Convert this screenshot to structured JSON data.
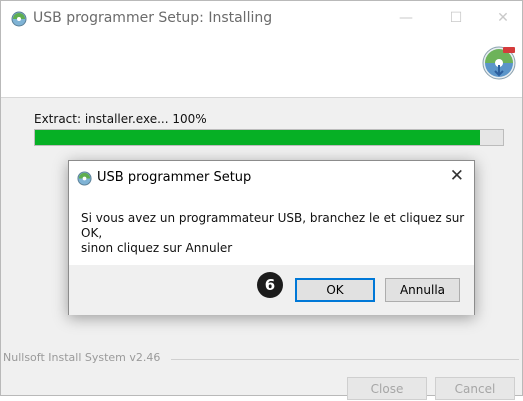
{
  "window": {
    "title": "USB programmer Setup: Installing",
    "controls": {
      "minimize": "—",
      "maximize": "☐",
      "close": "✕"
    }
  },
  "progress_area": {
    "status_text": "Extract: installer.exe... 100%",
    "progress_fraction": 0.95,
    "progress_color": "#06b025"
  },
  "footer": {
    "brand": "Nullsoft Install System v2.46",
    "close_label": "Close",
    "cancel_label": "Cancel"
  },
  "dialog": {
    "title": "USB programmer Setup",
    "close_glyph": "✕",
    "message_line1": "Si vous avez un programmateur USB, branchez le et cliquez sur OK,",
    "message_line2": "sinon cliquez sur Annuler",
    "ok_label": "OK",
    "cancel_label": "Annulla"
  },
  "annotation": {
    "step_number": "6"
  },
  "icons": {
    "app": "installer-disc-icon",
    "header": "installer-disc-icon"
  }
}
